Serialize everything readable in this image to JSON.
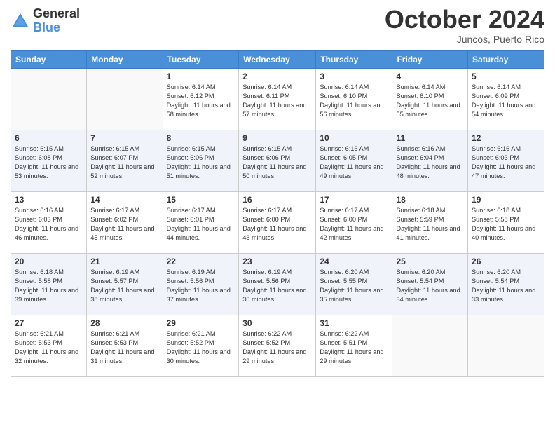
{
  "header": {
    "logo_line1": "General",
    "logo_line2": "Blue",
    "month": "October 2024",
    "location": "Juncos, Puerto Rico"
  },
  "weekdays": [
    "Sunday",
    "Monday",
    "Tuesday",
    "Wednesday",
    "Thursday",
    "Friday",
    "Saturday"
  ],
  "weeks": [
    [
      {
        "day": "",
        "info": ""
      },
      {
        "day": "",
        "info": ""
      },
      {
        "day": "1",
        "info": "Sunrise: 6:14 AM\nSunset: 6:12 PM\nDaylight: 11 hours and 58 minutes."
      },
      {
        "day": "2",
        "info": "Sunrise: 6:14 AM\nSunset: 6:11 PM\nDaylight: 11 hours and 57 minutes."
      },
      {
        "day": "3",
        "info": "Sunrise: 6:14 AM\nSunset: 6:10 PM\nDaylight: 11 hours and 56 minutes."
      },
      {
        "day": "4",
        "info": "Sunrise: 6:14 AM\nSunset: 6:10 PM\nDaylight: 11 hours and 55 minutes."
      },
      {
        "day": "5",
        "info": "Sunrise: 6:14 AM\nSunset: 6:09 PM\nDaylight: 11 hours and 54 minutes."
      }
    ],
    [
      {
        "day": "6",
        "info": "Sunrise: 6:15 AM\nSunset: 6:08 PM\nDaylight: 11 hours and 53 minutes."
      },
      {
        "day": "7",
        "info": "Sunrise: 6:15 AM\nSunset: 6:07 PM\nDaylight: 11 hours and 52 minutes."
      },
      {
        "day": "8",
        "info": "Sunrise: 6:15 AM\nSunset: 6:06 PM\nDaylight: 11 hours and 51 minutes."
      },
      {
        "day": "9",
        "info": "Sunrise: 6:15 AM\nSunset: 6:06 PM\nDaylight: 11 hours and 50 minutes."
      },
      {
        "day": "10",
        "info": "Sunrise: 6:16 AM\nSunset: 6:05 PM\nDaylight: 11 hours and 49 minutes."
      },
      {
        "day": "11",
        "info": "Sunrise: 6:16 AM\nSunset: 6:04 PM\nDaylight: 11 hours and 48 minutes."
      },
      {
        "day": "12",
        "info": "Sunrise: 6:16 AM\nSunset: 6:03 PM\nDaylight: 11 hours and 47 minutes."
      }
    ],
    [
      {
        "day": "13",
        "info": "Sunrise: 6:16 AM\nSunset: 6:03 PM\nDaylight: 11 hours and 46 minutes."
      },
      {
        "day": "14",
        "info": "Sunrise: 6:17 AM\nSunset: 6:02 PM\nDaylight: 11 hours and 45 minutes."
      },
      {
        "day": "15",
        "info": "Sunrise: 6:17 AM\nSunset: 6:01 PM\nDaylight: 11 hours and 44 minutes."
      },
      {
        "day": "16",
        "info": "Sunrise: 6:17 AM\nSunset: 6:00 PM\nDaylight: 11 hours and 43 minutes."
      },
      {
        "day": "17",
        "info": "Sunrise: 6:17 AM\nSunset: 6:00 PM\nDaylight: 11 hours and 42 minutes."
      },
      {
        "day": "18",
        "info": "Sunrise: 6:18 AM\nSunset: 5:59 PM\nDaylight: 11 hours and 41 minutes."
      },
      {
        "day": "19",
        "info": "Sunrise: 6:18 AM\nSunset: 5:58 PM\nDaylight: 11 hours and 40 minutes."
      }
    ],
    [
      {
        "day": "20",
        "info": "Sunrise: 6:18 AM\nSunset: 5:58 PM\nDaylight: 11 hours and 39 minutes."
      },
      {
        "day": "21",
        "info": "Sunrise: 6:19 AM\nSunset: 5:57 PM\nDaylight: 11 hours and 38 minutes."
      },
      {
        "day": "22",
        "info": "Sunrise: 6:19 AM\nSunset: 5:56 PM\nDaylight: 11 hours and 37 minutes."
      },
      {
        "day": "23",
        "info": "Sunrise: 6:19 AM\nSunset: 5:56 PM\nDaylight: 11 hours and 36 minutes."
      },
      {
        "day": "24",
        "info": "Sunrise: 6:20 AM\nSunset: 5:55 PM\nDaylight: 11 hours and 35 minutes."
      },
      {
        "day": "25",
        "info": "Sunrise: 6:20 AM\nSunset: 5:54 PM\nDaylight: 11 hours and 34 minutes."
      },
      {
        "day": "26",
        "info": "Sunrise: 6:20 AM\nSunset: 5:54 PM\nDaylight: 11 hours and 33 minutes."
      }
    ],
    [
      {
        "day": "27",
        "info": "Sunrise: 6:21 AM\nSunset: 5:53 PM\nDaylight: 11 hours and 32 minutes."
      },
      {
        "day": "28",
        "info": "Sunrise: 6:21 AM\nSunset: 5:53 PM\nDaylight: 11 hours and 31 minutes."
      },
      {
        "day": "29",
        "info": "Sunrise: 6:21 AM\nSunset: 5:52 PM\nDaylight: 11 hours and 30 minutes."
      },
      {
        "day": "30",
        "info": "Sunrise: 6:22 AM\nSunset: 5:52 PM\nDaylight: 11 hours and 29 minutes."
      },
      {
        "day": "31",
        "info": "Sunrise: 6:22 AM\nSunset: 5:51 PM\nDaylight: 11 hours and 29 minutes."
      },
      {
        "day": "",
        "info": ""
      },
      {
        "day": "",
        "info": ""
      }
    ]
  ]
}
